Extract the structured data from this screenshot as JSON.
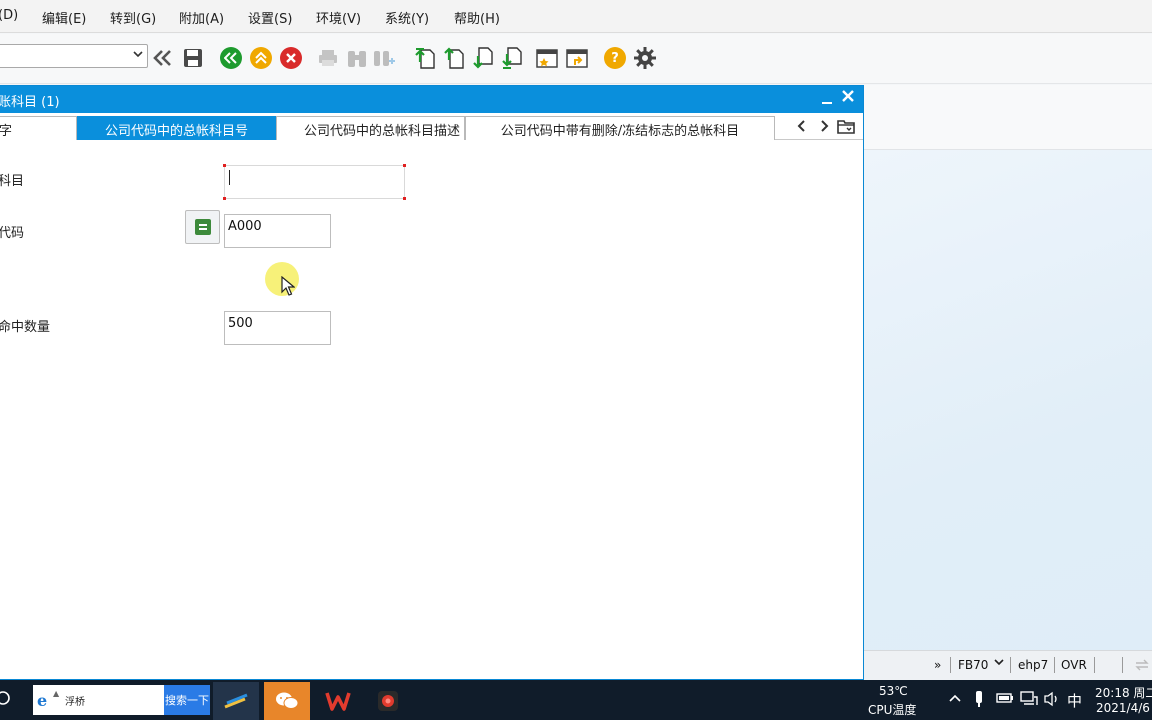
{
  "menu": {
    "items": [
      "(D)",
      "编辑(E)",
      "转到(G)",
      "附加(A)",
      "设置(S)",
      "环境(V)",
      "系统(Y)",
      "帮助(H)"
    ]
  },
  "toolbar": {
    "command_value": "",
    "icons": [
      "back-double-icon",
      "save-icon",
      "back-icon",
      "exit-icon",
      "cancel-icon",
      "print-icon",
      "find-icon",
      "find-next-icon",
      "first-page-icon",
      "previous-page-icon",
      "next-page-icon",
      "last-page-icon",
      "new-session-icon",
      "shortcut-icon",
      "help-icon",
      "settings-icon"
    ],
    "help_glyph": "?"
  },
  "dialog": {
    "title": "账科目 (1)",
    "tabs": [
      "字",
      "公司代码中的总帐科目号",
      "公司代码中的总帐科目描述",
      "公司代码中带有删除/冻结标志的总帐科目"
    ],
    "active_tab": 1
  },
  "form": {
    "account_label": "科目",
    "account_value": "",
    "company_code_label": "代码",
    "company_code_value": "A000",
    "max_hits_label": "命中数量",
    "max_hits_value": "500"
  },
  "statusbar": {
    "arrows": "»",
    "transaction": "FB70",
    "system": "ehp7",
    "mode": "OVR"
  },
  "taskbar": {
    "search_text": "浮桥",
    "search_button": "搜索一下",
    "temperature": "53℃",
    "temperature_label": "CPU温度",
    "ime": "中",
    "time": "20:18 周二",
    "date": "2021/4/6"
  },
  "colors": {
    "sap_blue": "#0a8fdc",
    "green": "#1e9b2e",
    "yellow": "#f0a800",
    "red": "#d92b2b",
    "taskbar": "#101c2a"
  }
}
